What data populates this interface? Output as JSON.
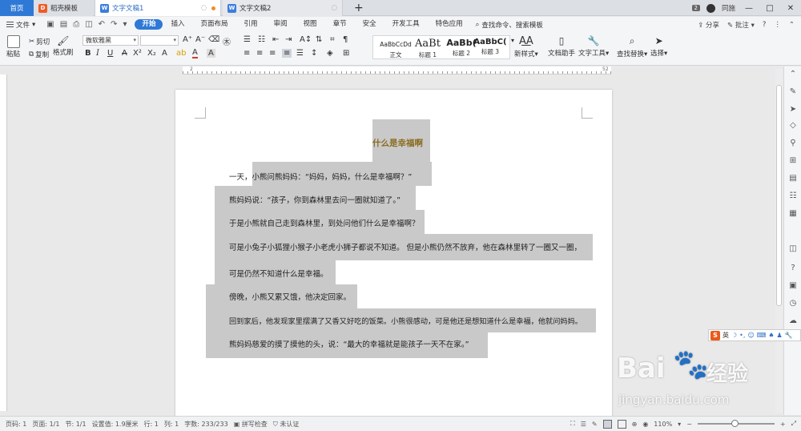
{
  "tabs": {
    "home": "首页",
    "template_tab": "稻壳模板",
    "doc1": "文字文稿1",
    "doc2": "文字文稿2",
    "new_tab": "+"
  },
  "titlebar": {
    "badge": "2",
    "user": "同施",
    "minimize": "—",
    "maximize": "□",
    "close": "✕"
  },
  "menu": {
    "file": "文件",
    "items": [
      "开始",
      "插入",
      "页面布局",
      "引用",
      "审阅",
      "视图",
      "章节",
      "安全",
      "开发工具",
      "特色应用"
    ],
    "search": "查找命令、搜索模板",
    "share": "分享",
    "comment": "批注",
    "help": "?"
  },
  "ribbon": {
    "paste": "粘贴",
    "cut": "剪切",
    "copy": "复制",
    "format_painter": "格式刷",
    "font_name": "微软雅黑",
    "font_size": "",
    "styles": [
      {
        "preview": "AaBbCcDd",
        "label": "正文"
      },
      {
        "preview": "AaBt",
        "label": "标题 1"
      },
      {
        "preview": "AaBb(",
        "label": "标题 2"
      },
      {
        "preview": "AaBbC(",
        "label": "标题 3"
      }
    ],
    "new_style": "新样式",
    "doc_assistant": "文档助手",
    "text_tools": "文字工具",
    "find_replace": "查找替换",
    "select": "选择"
  },
  "ruler": {
    "left_num": "2",
    "right_num": "52"
  },
  "document": {
    "title": "什么是幸福啊",
    "lines": [
      "一天，小熊问熊妈妈：“妈妈，妈妈，什么是幸福啊？”",
      "熊妈妈说：“孩子，你到森林里去问一圈就知道了。”",
      "于是小熊就自己走到森林里，到处问他们什么是幸福啊？",
      "可是小兔子小狐狸小猴子小老虎小狮子都说不知道。 但是小熊仍然不放弃，他在森林里转了一圈又一圈，",
      "可是仍然不知道什么是幸福。",
      "傍晚，小熊又累又饿，他决定回家。",
      "回到家后，他发现家里摆满了又香又好吃的饭菜。小熊很感动，可是他还是想知道什么是幸福，他就问妈妈。",
      "熊妈妈慈爱的摸了摸他的头，说：“最大的幸福就是能孩子一天不在家。”"
    ]
  },
  "ime": {
    "label": "英"
  },
  "watermark": {
    "brand": "Bai",
    "brand2": "经验",
    "url": "jingyan.baidu.com"
  },
  "statusbar": {
    "page_num": "页码: 1",
    "pages": "页面: 1/1",
    "section": "节: 1/1",
    "position": "设置值: 1.9厘米",
    "row": "行: 1",
    "col": "列: 1",
    "words": "字数: 233/233",
    "spell": "拼写检查",
    "cert": "未认证",
    "zoom": "110%",
    "zoom_minus": "−",
    "zoom_plus": "+"
  },
  "colors": {
    "accent": "#2f79d6",
    "title_text": "#8a6d22",
    "highlight": "#c9c9c9"
  }
}
